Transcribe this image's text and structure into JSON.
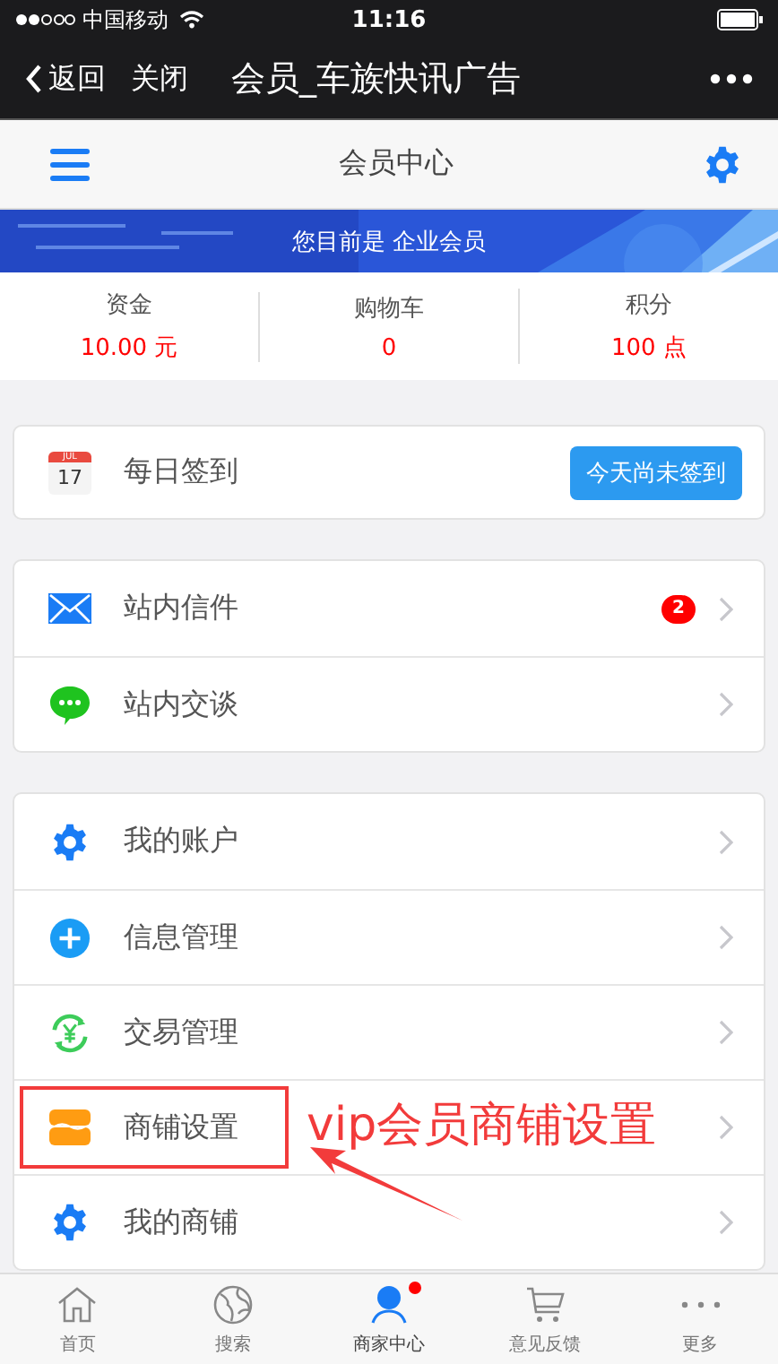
{
  "status_bar": {
    "carrier": "中国移动",
    "time": "11:16"
  },
  "nav_bar": {
    "back": "返回",
    "close": "关闭",
    "title": "会员_车族快讯广告"
  },
  "header": {
    "title": "会员中心"
  },
  "banner": {
    "text": "您目前是 企业会员"
  },
  "stats": [
    {
      "label": "资金",
      "value": "10.00 元"
    },
    {
      "label": "购物车",
      "value": "0"
    },
    {
      "label": "积分",
      "value": "100 点"
    }
  ],
  "checkin": {
    "month": "JUL",
    "day": "17",
    "label": "每日签到",
    "button": "今天尚未签到"
  },
  "menu_groups": [
    [
      {
        "kind": "mail",
        "label": "站内信件",
        "badge": "2"
      },
      {
        "kind": "chat",
        "label": "站内交谈"
      }
    ],
    [
      {
        "kind": "gear",
        "label": "我的账户"
      },
      {
        "kind": "plus",
        "label": "信息管理"
      },
      {
        "kind": "yen",
        "label": "交易管理"
      },
      {
        "kind": "shop",
        "label": "商铺设置",
        "annotated": true
      },
      {
        "kind": "gear",
        "label": "我的商铺"
      }
    ]
  ],
  "annotation": {
    "text": "vip会员商铺设置"
  },
  "tab_bar": [
    {
      "kind": "home",
      "label": "首页",
      "selected": false,
      "dot": false
    },
    {
      "kind": "globe",
      "label": "搜索",
      "selected": false,
      "dot": false
    },
    {
      "kind": "person",
      "label": "商家中心",
      "selected": true,
      "dot": true
    },
    {
      "kind": "cart",
      "label": "意见反馈",
      "selected": false,
      "dot": false
    },
    {
      "kind": "more",
      "label": "更多",
      "selected": false,
      "dot": false
    }
  ]
}
